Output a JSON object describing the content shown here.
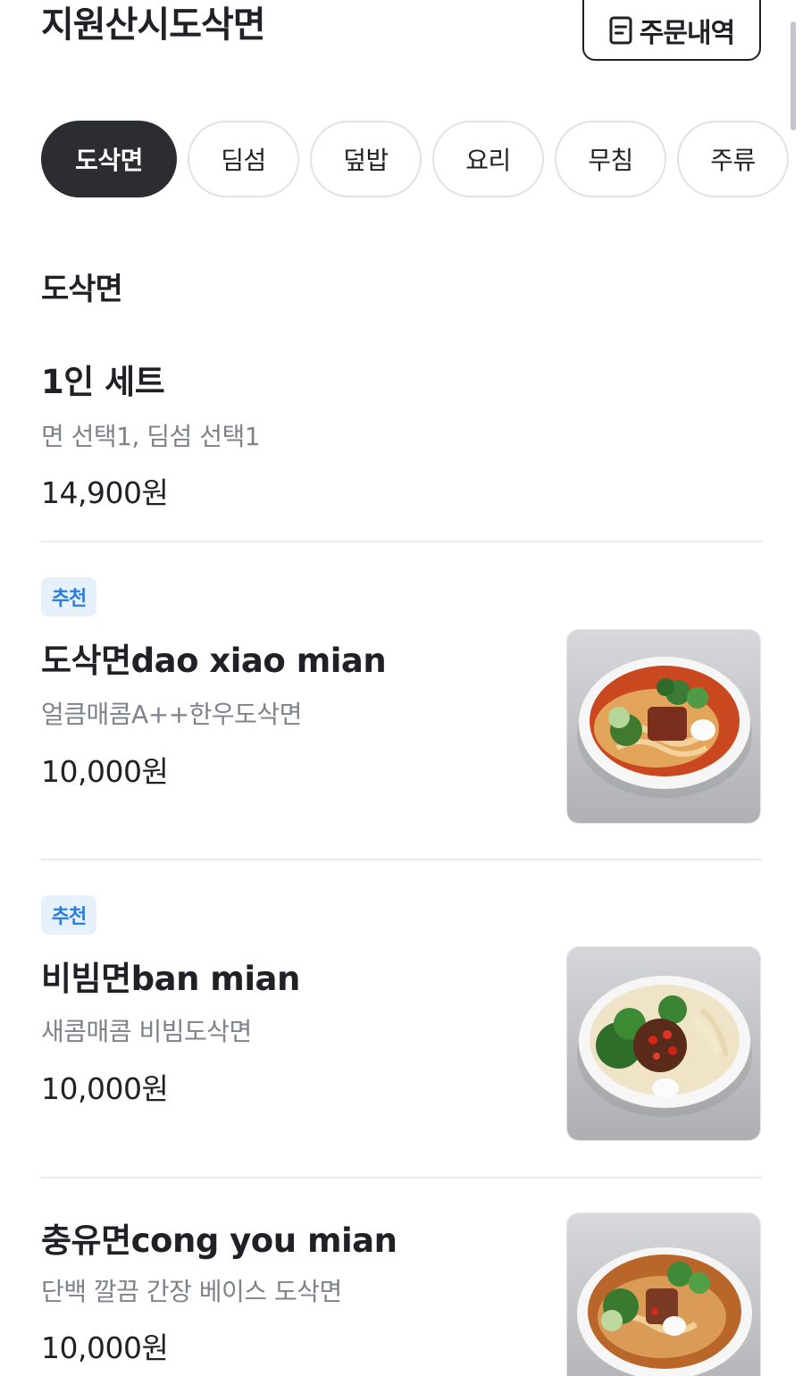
{
  "header": {
    "store_name": "지원산시도삭면",
    "order_history_label": "주문내역",
    "order_history_icon": "receipt-icon"
  },
  "categories": [
    {
      "label": "도삭면",
      "active": true
    },
    {
      "label": "딤섬",
      "active": false
    },
    {
      "label": "덮밥",
      "active": false
    },
    {
      "label": "요리",
      "active": false
    },
    {
      "label": "무침",
      "active": false
    },
    {
      "label": "주류",
      "active": false
    }
  ],
  "section": {
    "title": "도삭면"
  },
  "menu_items": [
    {
      "name": "1인 세트",
      "description": "면 선택1, 딤섬 선택1",
      "price": "14,900원",
      "badge": null,
      "has_image": false
    },
    {
      "name": "도삭면dao xiao mian",
      "description": "얼큼매콤A++한우도삭면",
      "price": "10,000원",
      "badge": "추천",
      "has_image": true,
      "image_desc": "red-broth-noodle-bowl"
    },
    {
      "name": "비빔면ban mian",
      "description": "새콤매콤 비빔도삭면",
      "price": "10,000원",
      "badge": "추천",
      "has_image": true,
      "image_desc": "mixed-noodle-bowl"
    },
    {
      "name": "충유면cong you mian",
      "description": "단백 깔끔 간장 베이스 도삭면",
      "price": "10,000원",
      "badge": null,
      "has_image": true,
      "image_desc": "soy-broth-noodle-bowl"
    }
  ],
  "colors": {
    "text_primary": "#1f2126",
    "text_secondary": "#7d828b",
    "active_tab_bg": "#2b2d31",
    "badge_bg": "#e6f1fb",
    "badge_text": "#2c7be0",
    "divider": "#e9ebee"
  }
}
